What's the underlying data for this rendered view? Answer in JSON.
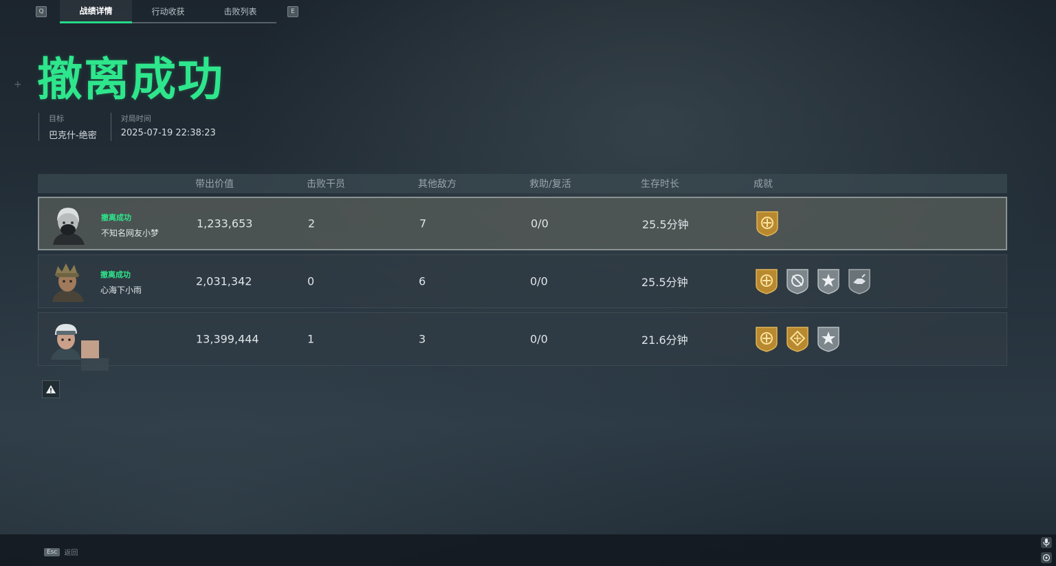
{
  "tabs": {
    "left_key": "Q",
    "right_key": "E",
    "items": [
      "战绩详情",
      "行动收获",
      "击败列表"
    ]
  },
  "result_title": "撤离成功",
  "meta": {
    "target_label": "目标",
    "target_value": "巴克什-绝密",
    "time_label": "对局时间",
    "time_value": "2025-07-19 22:38:23"
  },
  "table": {
    "headers": [
      "带出价值",
      "击败干员",
      "其他敌方",
      "救助/复活",
      "生存时长",
      "成就"
    ],
    "rows": [
      {
        "status": "撤离成功",
        "name": "不知名网友小梦",
        "value": "1,233,653",
        "operator_kills": "2",
        "other_enemies": "7",
        "assist_revive": "0/0",
        "survival": "25.5分钟",
        "achievements": [
          "gold-extract-badge"
        ]
      },
      {
        "status": "撤离成功",
        "name": "心海下小雨",
        "value": "2,031,342",
        "operator_kills": "0",
        "other_enemies": "6",
        "assist_revive": "0/0",
        "survival": "25.5分钟",
        "achievements": [
          "gold-extract-badge",
          "silver-no-damage-badge",
          "silver-star-badge",
          "silver-hand-badge"
        ]
      },
      {
        "status": "",
        "name": "",
        "value": "13,399,444",
        "operator_kills": "1",
        "other_enemies": "3",
        "assist_revive": "0/0",
        "survival": "21.6分钟",
        "achievements": [
          "gold-extract-badge",
          "gold-grid-badge",
          "silver-star-badge"
        ]
      }
    ]
  },
  "footer": {
    "esc_key": "Esc",
    "esc_label": "返回"
  },
  "colors": {
    "accent_green": "#2ee68c",
    "gold_badge": "#b8892e",
    "silver_badge": "#8e979c"
  }
}
